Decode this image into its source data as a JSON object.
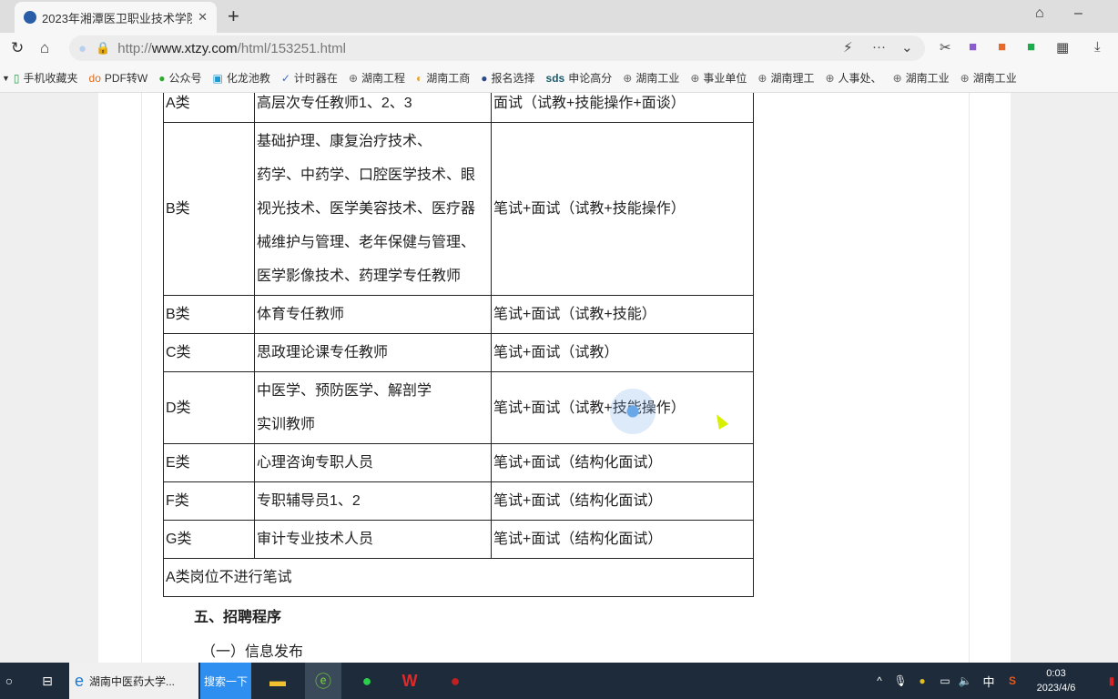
{
  "browser": {
    "tab_title": "2023年湘潭医卫职业技术学院",
    "url_prefix": "http://",
    "url_domain": "www.xtzy.com",
    "url_path": "/html/153251.html"
  },
  "bookmarks": [
    {
      "icon": "phone-icon",
      "label": "手机收藏夹"
    },
    {
      "icon": "pdf-icon",
      "label": "PDF转W"
    },
    {
      "icon": "wechat-icon",
      "label": "公众号"
    },
    {
      "icon": "tv-icon",
      "label": "化龙池教"
    },
    {
      "icon": "timer-icon",
      "label": "计时器在"
    },
    {
      "icon": "globe-icon",
      "label": "湖南工程"
    },
    {
      "icon": "color-icon",
      "label": "湖南工商"
    },
    {
      "icon": "seal-icon",
      "label": "报名选择"
    },
    {
      "icon": "sds-icon",
      "label": "申论高分"
    },
    {
      "icon": "globe-icon",
      "label": "湖南工业"
    },
    {
      "icon": "globe-icon",
      "label": "事业单位"
    },
    {
      "icon": "globe-icon",
      "label": "湖南理工"
    },
    {
      "icon": "globe-icon",
      "label": "人事处、"
    },
    {
      "icon": "globe-icon",
      "label": "湖南工业"
    },
    {
      "icon": "globe-icon",
      "label": "湖南工业"
    }
  ],
  "table": {
    "rows": [
      {
        "cat": "A类",
        "pos": [
          "高层次专任教师1、2、3"
        ],
        "exam": "面试（试教+技能操作+面谈）"
      },
      {
        "cat": "B类",
        "pos": [
          "基础护理、康复治疗技术、",
          "药学、中药学、口腔医学技术、眼",
          "视光技术、医学美容技术、医疗器",
          "械维护与管理、老年保健与管理、",
          "医学影像技术、药理学专任教师"
        ],
        "exam": "笔试+面试（试教+技能操作）"
      },
      {
        "cat": "B类",
        "pos": [
          "体育专任教师"
        ],
        "exam": "笔试+面试（试教+技能）"
      },
      {
        "cat": "C类",
        "pos": [
          "思政理论课专任教师"
        ],
        "exam": "笔试+面试（试教）"
      },
      {
        "cat": "D类",
        "pos": [
          "中医学、预防医学、解剖学",
          "实训教师"
        ],
        "exam": "笔试+面试（试教+技能操作）"
      },
      {
        "cat": "E类",
        "pos": [
          "心理咨询专职人员"
        ],
        "exam": "笔试+面试（结构化面试）"
      },
      {
        "cat": "F类",
        "pos": [
          "专职辅导员1、2"
        ],
        "exam": "笔试+面试（结构化面试）"
      },
      {
        "cat": "G类",
        "pos": [
          "审计专业技术人员"
        ],
        "exam": "笔试+面试（结构化面试）"
      }
    ],
    "note": "A类岗位不进行笔试"
  },
  "section_heading": "五、招聘程序",
  "subsection_heading": "（一）信息发布",
  "taskbar": {
    "ie_label": "湖南中医药大学...",
    "search_label": "搜索一下",
    "ime": "中",
    "time": "0:03",
    "date": "2023/4/6"
  }
}
